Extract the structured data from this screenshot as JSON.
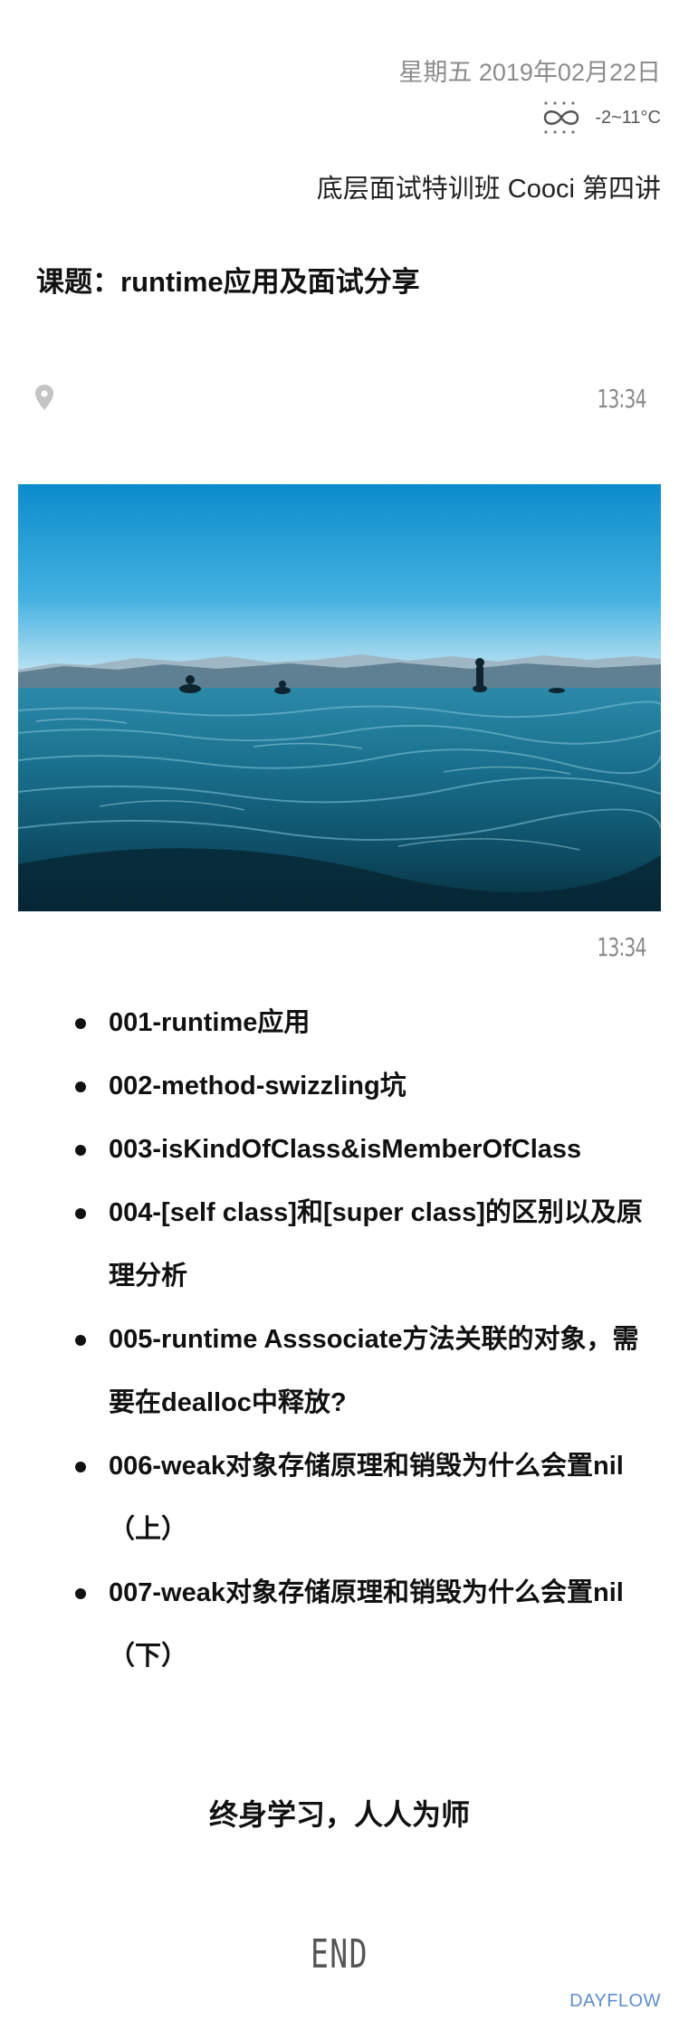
{
  "header": {
    "date": "星期五 2019年02月22日",
    "weather_icon": "fog-icon",
    "temperature": "-2~11°C"
  },
  "subtitle": "底层面试特训班 Cooci 第四讲",
  "topic": "课题：runtime应用及面试分享",
  "location_icon": "location-pin-icon",
  "time_top": "13:34",
  "photo_icon": "ocean-photo",
  "time_bottom": "13:34",
  "items": [
    "001-runtime应用",
    "002-method-swizzling坑",
    "003-isKindOfClass&isMemberOfClass",
    "004-[self class]和[super class]的区别以及原理分析",
    "005-runtime Asssociate方法关联的对象，需要在dealloc中释放?",
    "006-weak对象存储原理和销毁为什么会置nil（上）",
    "007-weak对象存储原理和销毁为什么会置nil（下）"
  ],
  "motto": "终身学习，人人为师",
  "end_label": "END",
  "brand": "DAYFLOW",
  "colors": {
    "date": "#8c8c8c",
    "brand": "#5f8ec9",
    "sea_top": "#0c93cf",
    "sea_deep": "#0a3a4d"
  }
}
